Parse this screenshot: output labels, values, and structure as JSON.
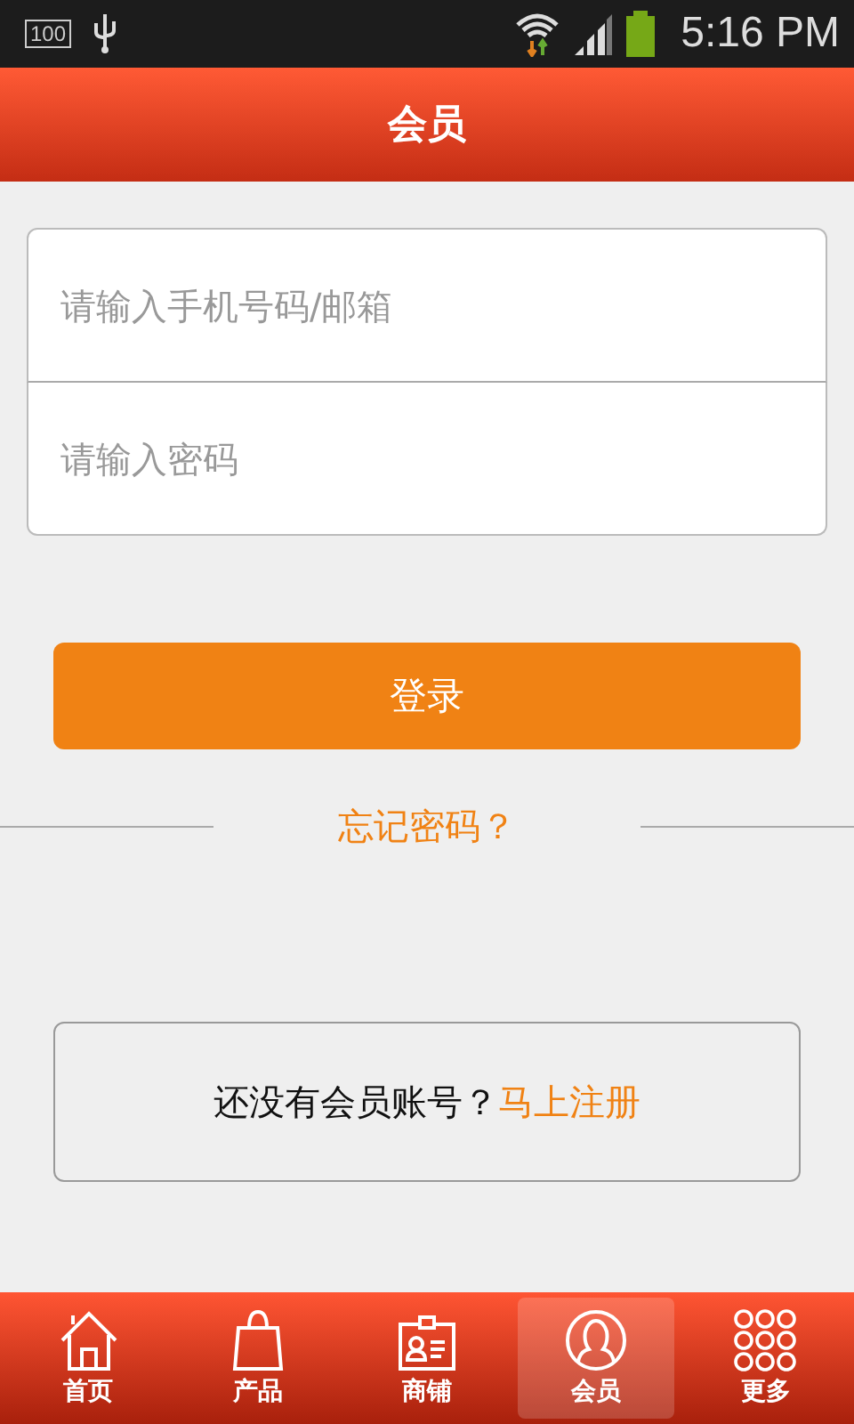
{
  "status_bar": {
    "battery_badge": "100",
    "time": "5:16 PM"
  },
  "header": {
    "title": "会员"
  },
  "fields": [
    {
      "placeholder": "请输入手机号码/邮箱"
    },
    {
      "placeholder": "请输入密码"
    }
  ],
  "login_button": "登录",
  "forgot_link": "忘记密码？",
  "register": {
    "prompt": "还没有会员账号？",
    "link": "马上注册"
  },
  "tabs": [
    {
      "label": "首页",
      "kind": "home",
      "selected": false
    },
    {
      "label": "产品",
      "kind": "bag",
      "selected": false
    },
    {
      "label": "商铺",
      "kind": "badge",
      "selected": false
    },
    {
      "label": "会员",
      "kind": "user",
      "selected": true
    },
    {
      "label": "更多",
      "kind": "grid",
      "selected": false
    }
  ]
}
